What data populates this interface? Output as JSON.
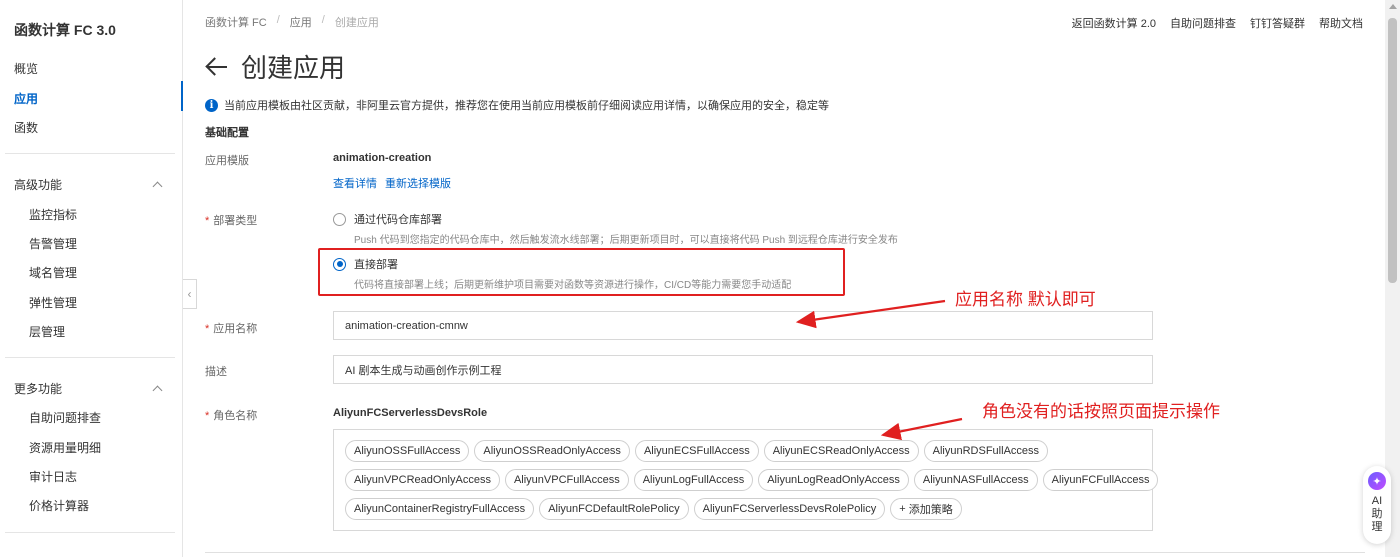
{
  "sidebar": {
    "brand": "函数计算 FC 3.0",
    "items": [
      {
        "label": "概览"
      },
      {
        "label": "应用"
      },
      {
        "label": "函数"
      }
    ],
    "groups": [
      {
        "title": "高级功能",
        "items": [
          "监控指标",
          "告警管理",
          "域名管理",
          "弹性管理",
          "层管理"
        ]
      },
      {
        "title": "更多功能",
        "items": [
          "自助问题排查",
          "资源用量明细",
          "审计日志",
          "价格计算器"
        ]
      }
    ]
  },
  "breadcrumb": [
    "函数计算 FC",
    "应用",
    "创建应用"
  ],
  "top_links": [
    "返回函数计算 2.0",
    "自助问题排查",
    "钉钉答疑群",
    "帮助文档"
  ],
  "page": {
    "title": "创建应用",
    "notice": "当前应用模板由社区贡献，非阿里云官方提供，推荐您在使用当前应用模板前仔细阅读应用详情，以确保应用的安全，稳定等",
    "section_title": "基础配置"
  },
  "form": {
    "template": {
      "label": "应用模版",
      "value": "animation-creation",
      "link_details": "查看详情",
      "link_reselect": "重新选择模版"
    },
    "deploy_type": {
      "label": "部署类型",
      "options": [
        {
          "label": "通过代码仓库部署",
          "desc": "Push 代码到您指定的代码仓库中，然后触发流水线部署；后期更新项目时，可以直接将代码 Push 到远程仓库进行安全发布",
          "checked": false
        },
        {
          "label": "直接部署",
          "desc": "代码将直接部署上线；后期更新维护项目需要对函数等资源进行操作，CI/CD等能力需要您手动适配",
          "checked": true
        }
      ]
    },
    "app_name": {
      "label": "应用名称",
      "value": "animation-creation-cmnw"
    },
    "description": {
      "label": "描述",
      "value": "AI 剧本生成与动画创作示例工程"
    },
    "role": {
      "label": "角色名称",
      "value": "AliyunFCServerlessDevsRole",
      "policies_rows": [
        [
          "AliyunOSSFullAccess",
          "AliyunOSSReadOnlyAccess",
          "AliyunECSFullAccess",
          "AliyunECSReadOnlyAccess",
          "AliyunRDSFullAccess"
        ],
        [
          "AliyunVPCReadOnlyAccess",
          "AliyunVPCFullAccess",
          "AliyunLogFullAccess",
          "AliyunLogReadOnlyAccess",
          "AliyunNASFullAccess",
          "AliyunFCFullAccess"
        ],
        [
          "AliyunContainerRegistryFullAccess",
          "AliyunFCDefaultRolePolicy",
          "AliyunFCServerlessDevsRolePolicy"
        ]
      ],
      "add_policy": "添加策略"
    }
  },
  "annotations": {
    "app_name_note": "应用名称 默认即可",
    "role_note": "角色没有的话按照页面提示操作",
    "color": "#e02020"
  },
  "ai_assistant": {
    "label": "AI助理"
  },
  "colors": {
    "accent": "#0064c8",
    "required": "#d93026",
    "annotation": "#e02020"
  }
}
